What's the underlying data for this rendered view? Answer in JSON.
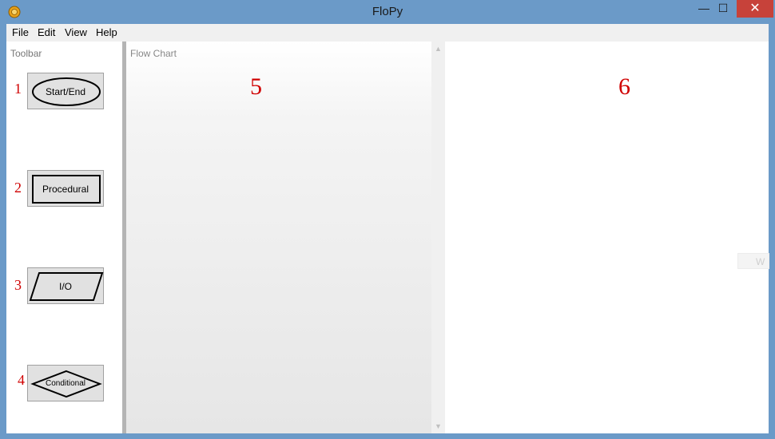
{
  "window": {
    "title": "FloPy",
    "controls": {
      "minimize": "—",
      "maximize": "☐",
      "close": "✕"
    },
    "accent_color": "#6b9ac8",
    "close_color": "#c7423a"
  },
  "menu": {
    "items": [
      "File",
      "Edit",
      "View",
      "Help"
    ]
  },
  "toolbar": {
    "label": "Toolbar",
    "buttons": [
      {
        "number": "1",
        "label": "Start/End",
        "shape": "ellipse-icon"
      },
      {
        "number": "2",
        "label": "Procedural",
        "shape": "rectangle-icon"
      },
      {
        "number": "3",
        "label": "I/O",
        "shape": "parallelogram-icon"
      },
      {
        "number": "4",
        "label": "Conditional",
        "shape": "diamond-icon"
      }
    ]
  },
  "flowchart": {
    "label": "Flow Chart",
    "number": "5"
  },
  "right_panel": {
    "number": "6",
    "faint_text": "W"
  },
  "annotation_color": "#d00000"
}
